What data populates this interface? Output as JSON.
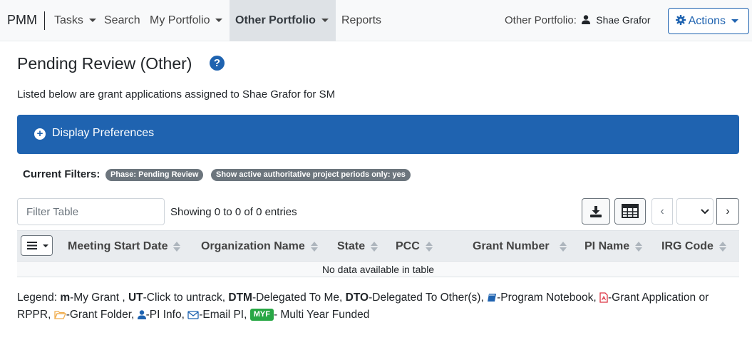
{
  "navbar": {
    "brand": "PMM",
    "items": [
      {
        "label": "Tasks",
        "dropdown": true
      },
      {
        "label": "Search",
        "dropdown": false
      },
      {
        "label": "My Portfolio",
        "dropdown": true
      },
      {
        "label": "Other Portfolio",
        "dropdown": true,
        "active": true
      },
      {
        "label": "Reports",
        "dropdown": false
      }
    ],
    "portfolio_label": "Other Portfolio:",
    "portfolio_user": "Shae Grafor",
    "actions_label": "Actions"
  },
  "page": {
    "title": "Pending Review (Other)",
    "help_icon": "question-circle-icon",
    "description": "Listed below are grant applications assigned to Shae Grafor for SM"
  },
  "prefs_panel": {
    "label": "Display Preferences",
    "icon": "plus-circle-icon"
  },
  "filters": {
    "label": "Current Filters:",
    "badges": [
      "Phase: Pending Review",
      "Show active authoritative project periods only: yes"
    ]
  },
  "table_controls": {
    "filter_placeholder": "Filter Table",
    "filter_value": "",
    "showing_text": "Showing 0 to 0 of 0 entries",
    "prev_symbol": "‹",
    "next_symbol": "›"
  },
  "table": {
    "columns": [
      "Meeting Start Date",
      "Organization Name",
      "State",
      "PCC",
      "Grant Number",
      "PI Name",
      "IRG Code"
    ],
    "empty_message": "No data available in table"
  },
  "legend": {
    "prefix": "Legend:",
    "items": [
      {
        "key": "m",
        "desc": "-My Grant ,"
      },
      {
        "key": "UT",
        "desc": "-Click to untrack,"
      },
      {
        "key": "DTM",
        "desc": "-Delegated To Me,"
      },
      {
        "key": "DTO",
        "desc": "-Delegated To Other(s),"
      }
    ],
    "icon_items": [
      {
        "icon": "notebook-icon",
        "desc": "-Program Notebook,"
      },
      {
        "icon": "pdf-icon",
        "desc": "-Grant Application or RPPR,"
      },
      {
        "icon": "folder-icon",
        "desc": "-Grant Folder,"
      },
      {
        "icon": "user-icon",
        "desc": "-PI Info,"
      },
      {
        "icon": "envelope-icon",
        "desc": "-Email PI,"
      }
    ],
    "myf_badge": "MYF",
    "myf_desc": "- Multi Year Funded"
  },
  "colors": {
    "primary": "#1f63b0",
    "badge_gray": "#6c757d",
    "myf_green": "#28a745",
    "pdf_red": "#dc3545",
    "folder_orange": "#f0ad4e"
  }
}
